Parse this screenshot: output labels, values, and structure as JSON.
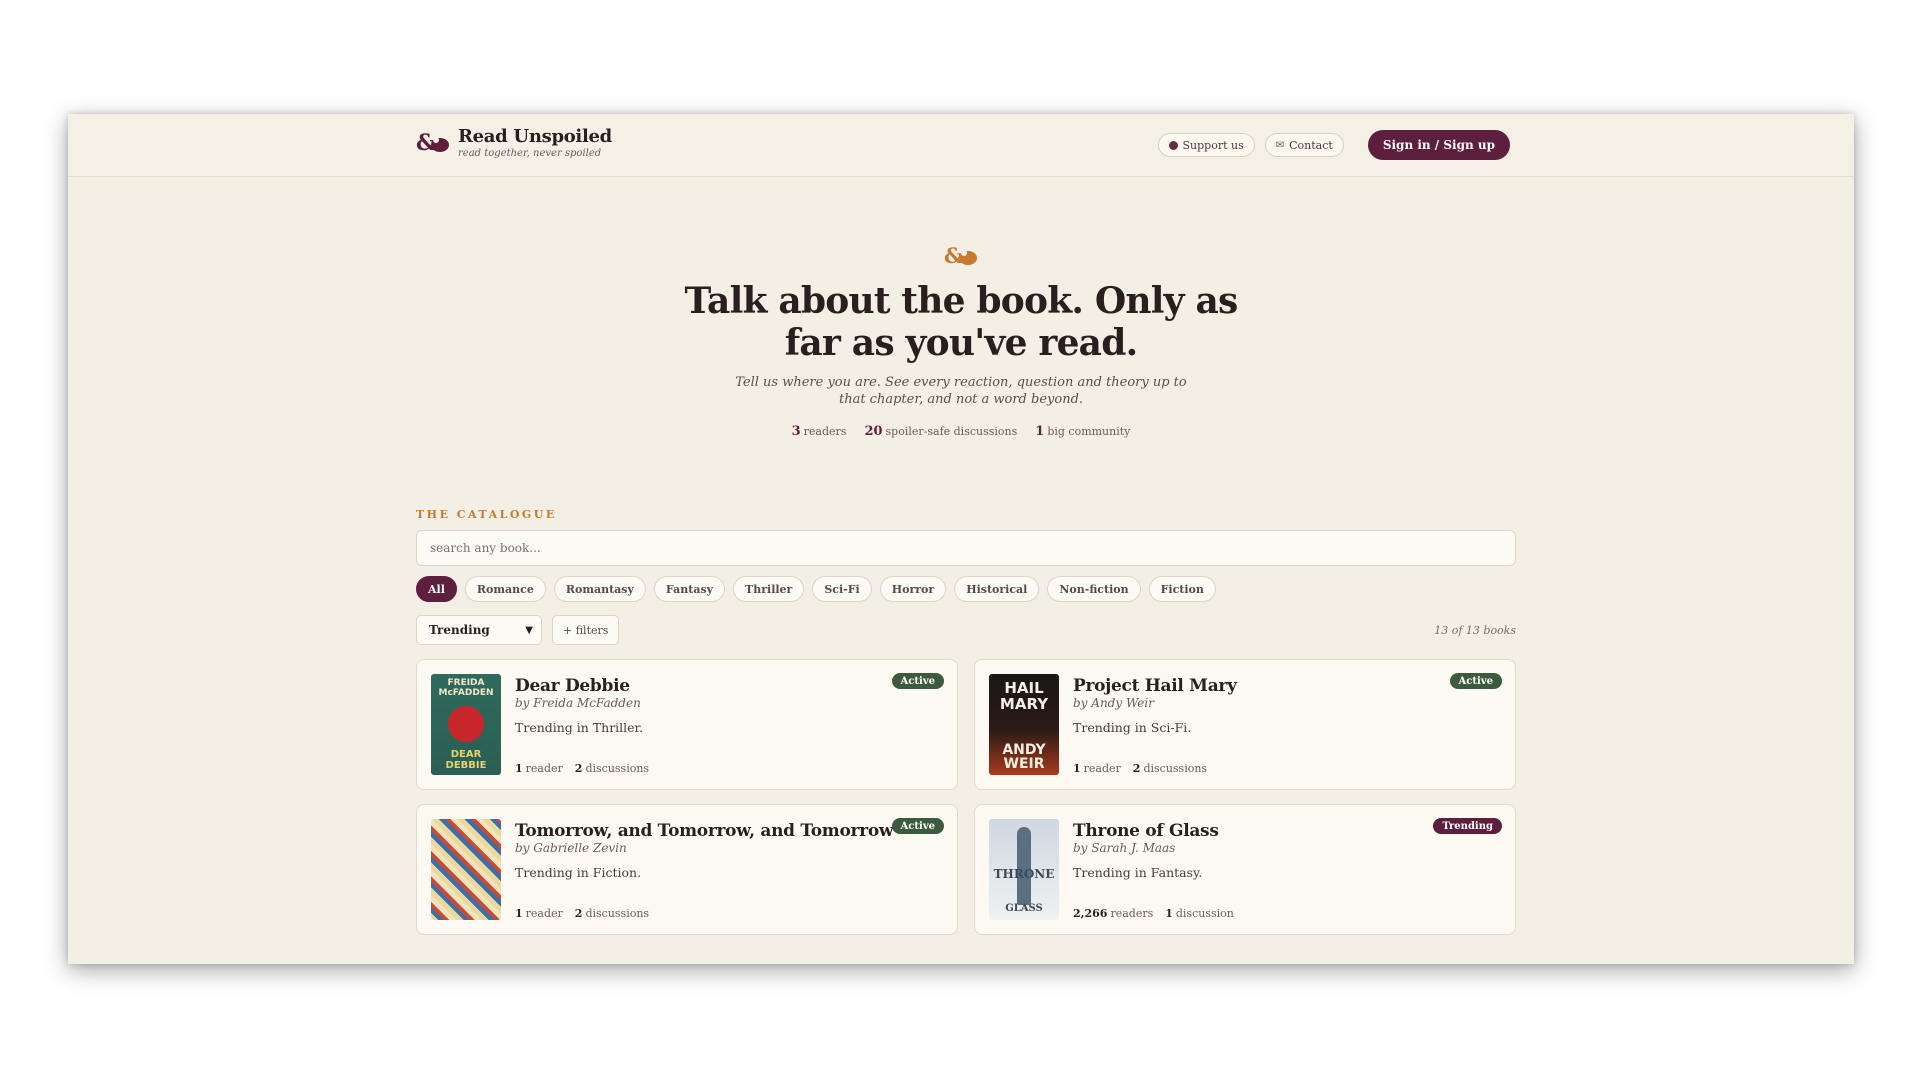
{
  "brand": {
    "title": "Read Unspoiled",
    "tagline": "read together, never spoiled"
  },
  "nav": {
    "support_label": "Support us",
    "contact_label": "Contact",
    "signin_label": "Sign in / Sign up"
  },
  "hero": {
    "title": "Talk about the book. Only as far as you've read.",
    "subtitle": "Tell us where you are. See every reaction, question and theory up to that chapter, and not a word beyond.",
    "stats": [
      {
        "value": "3",
        "label": "readers"
      },
      {
        "value": "20",
        "label": "spoiler-safe discussions"
      },
      {
        "value": "1",
        "label": "big community"
      }
    ]
  },
  "catalogue": {
    "label": "THE CATALOGUE",
    "search_placeholder": "search any book...",
    "genres": [
      "All",
      "Romance",
      "Romantasy",
      "Fantasy",
      "Thriller",
      "Sci-Fi",
      "Horror",
      "Historical",
      "Non-fiction",
      "Fiction"
    ],
    "active_genre": "All",
    "sort_value": "Trending",
    "filters_label": "+ filters",
    "count_text": "13 of 13 books"
  },
  "books": [
    {
      "title": "Dear Debbie",
      "author": "by Freida McFadden",
      "desc": "Trending in Thriller.",
      "readers_value": "1",
      "readers_label": "reader",
      "discussions_value": "2",
      "discussions_label": "discussions",
      "badge": "Active",
      "cover_top": "FREIDA McFADDEN",
      "cover_bottom": "DEAR DEBBIE"
    },
    {
      "title": "Project Hail Mary",
      "author": "by Andy Weir",
      "desc": "Trending in Sci-Fi.",
      "readers_value": "1",
      "readers_label": "reader",
      "discussions_value": "2",
      "discussions_label": "discussions",
      "badge": "Active",
      "cover_top": "HAIL MARY",
      "cover_bottom": "ANDY WEIR"
    },
    {
      "title": "Tomorrow, and Tomorrow, and Tomorrow",
      "author": "by Gabrielle Zevin",
      "desc": "Trending in Fiction.",
      "readers_value": "1",
      "readers_label": "reader",
      "discussions_value": "2",
      "discussions_label": "discussions",
      "badge": "Active"
    },
    {
      "title": "Throne of Glass",
      "author": "by Sarah J. Maas",
      "desc": "Trending in Fantasy.",
      "readers_value": "2,266",
      "readers_label": "readers",
      "discussions_value": "1",
      "discussions_label": "discussion",
      "badge": "Trending",
      "cover_mid": "THRONE",
      "cover_bottom": "GLASS"
    }
  ],
  "colors": {
    "accent": "#5e1f3e",
    "active_badge": "#3c5a3e",
    "label_orange": "#c57a2e",
    "background": "#f4efe5"
  }
}
